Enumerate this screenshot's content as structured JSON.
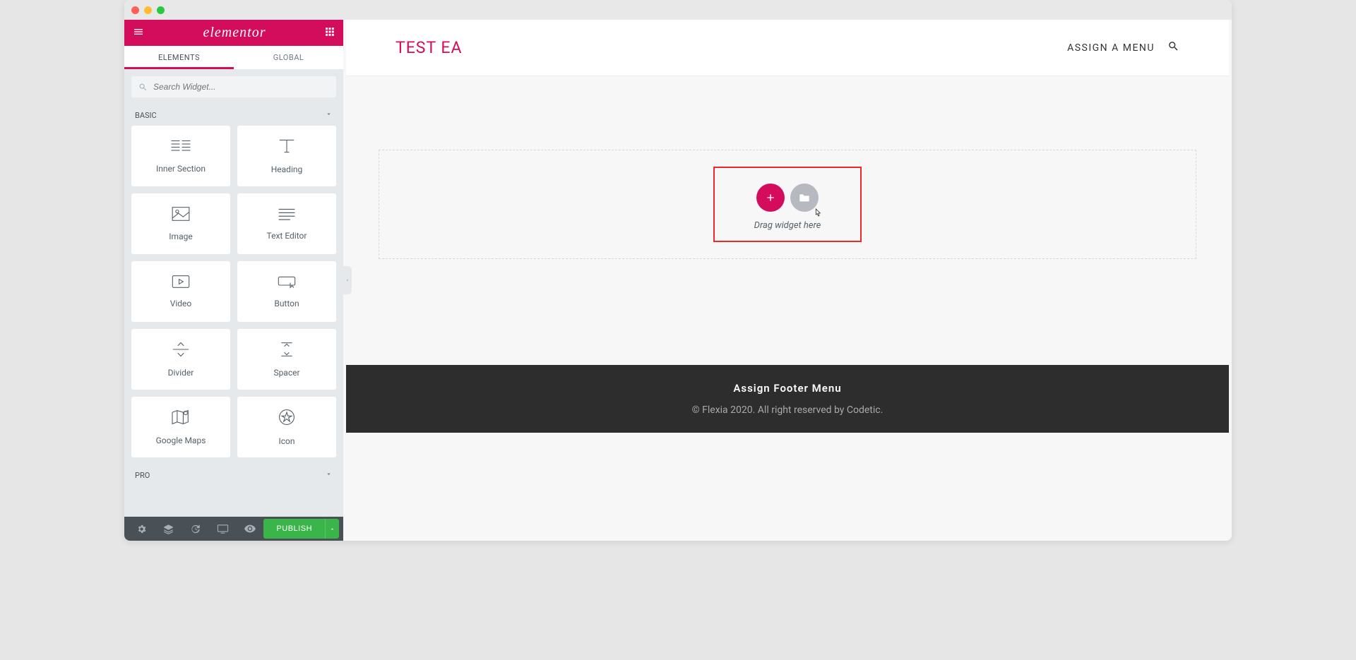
{
  "brand": "elementor",
  "tabs": {
    "elements": "ELEMENTS",
    "global": "GLOBAL"
  },
  "search": {
    "placeholder": "Search Widget..."
  },
  "categories": {
    "basic": "BASIC",
    "pro": "PRO"
  },
  "widgets": {
    "inner_section": "Inner Section",
    "heading": "Heading",
    "image": "Image",
    "text_editor": "Text Editor",
    "video": "Video",
    "button": "Button",
    "divider": "Divider",
    "spacer": "Spacer",
    "google_maps": "Google Maps",
    "icon": "Icon"
  },
  "publish": "PUBLISH",
  "page": {
    "title": "TEST EA",
    "assign_menu": "ASSIGN A MENU",
    "drag_hint": "Drag widget here",
    "footer_menu": "Assign Footer Menu",
    "footer_copy": "© Flexia 2020. All right reserved by Codetic."
  },
  "colors": {
    "accent": "#d30c5c",
    "green": "#39b54a"
  }
}
